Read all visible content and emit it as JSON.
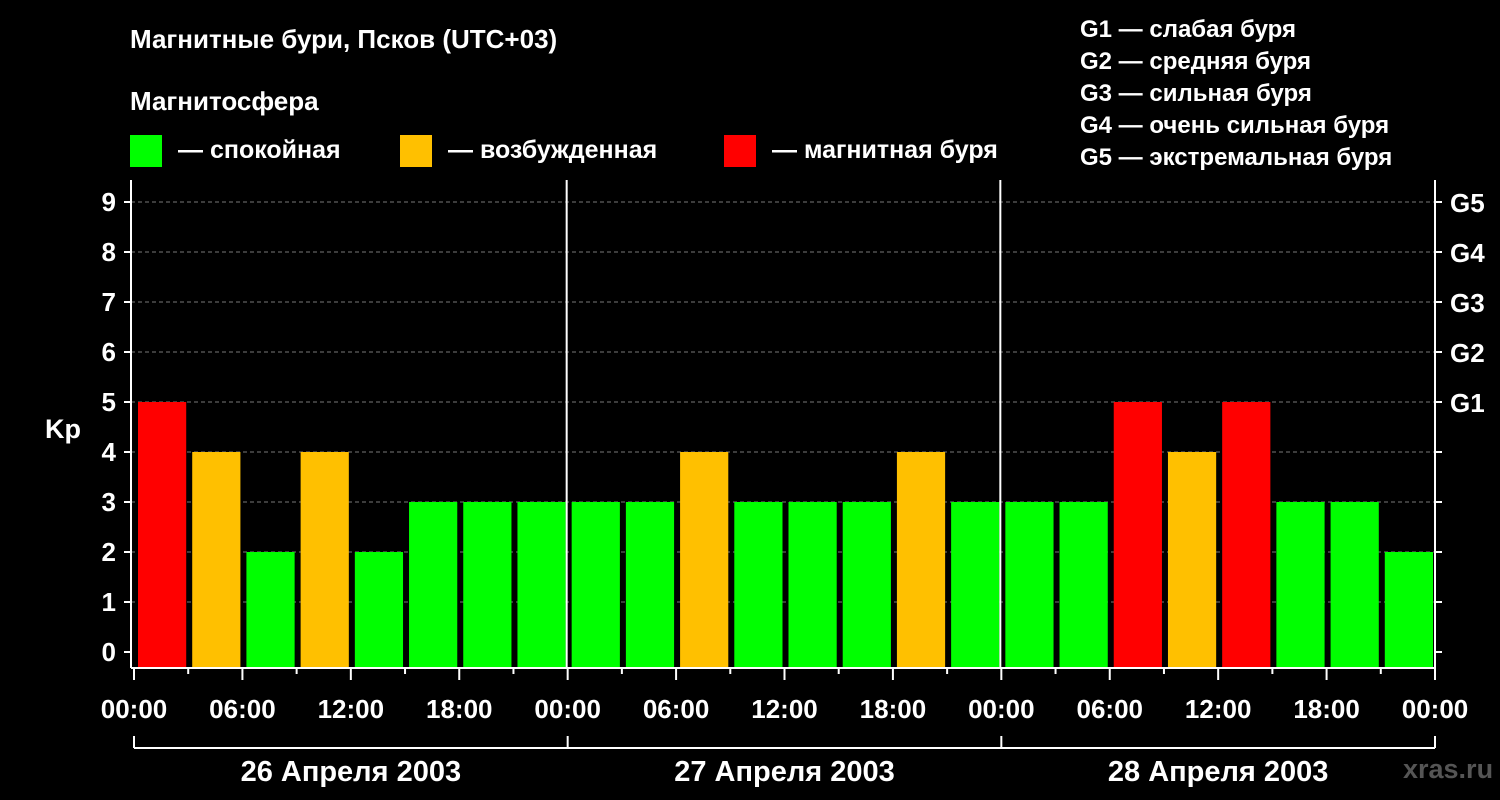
{
  "header": {
    "title": "Магнитные бури, Псков (UTC+03)",
    "subtitle": "Магнитосфера"
  },
  "legend": [
    {
      "label": "— спокойная",
      "color": "#00ff00"
    },
    {
      "label": "— возбужденная",
      "color": "#ffc000"
    },
    {
      "label": "— магнитная буря",
      "color": "#ff0000"
    }
  ],
  "g_legend": [
    "G1 — слабая буря",
    "G2 — средняя буря",
    "G3 — сильная буря",
    "G4 — очень сильная буря",
    "G5 — экстремальная буря"
  ],
  "watermark": "xras.ru",
  "chart_data": {
    "type": "bar",
    "ylabel": "Kp",
    "ylim": [
      0,
      9
    ],
    "y_ticks": [
      "0",
      "1",
      "2",
      "3",
      "4",
      "5",
      "6",
      "7",
      "8",
      "9"
    ],
    "g_ticks": [
      {
        "kp": 5,
        "label": "G1"
      },
      {
        "kp": 6,
        "label": "G2"
      },
      {
        "kp": 7,
        "label": "G3"
      },
      {
        "kp": 8,
        "label": "G4"
      },
      {
        "kp": 9,
        "label": "G5"
      }
    ],
    "x_tick_labels": [
      "00:00",
      "06:00",
      "12:00",
      "18:00",
      "00:00",
      "06:00",
      "12:00",
      "18:00",
      "00:00",
      "06:00",
      "12:00",
      "18:00",
      "00:00"
    ],
    "days": [
      "26 Апреля 2003",
      "27 Апреля 2003",
      "28 Апреля 2003"
    ],
    "bins_per_day": 8,
    "values": [
      5,
      4,
      2,
      4,
      2,
      3,
      3,
      3,
      3,
      3,
      4,
      3,
      3,
      3,
      4,
      3,
      3,
      3,
      5,
      4,
      5,
      3,
      3,
      2
    ],
    "color_rules": {
      "quiet_max": 3,
      "active": 4,
      "storm_min": 5
    },
    "colors": {
      "quiet": "#00ff00",
      "active": "#ffc000",
      "storm": "#ff0000"
    },
    "grid": true
  }
}
